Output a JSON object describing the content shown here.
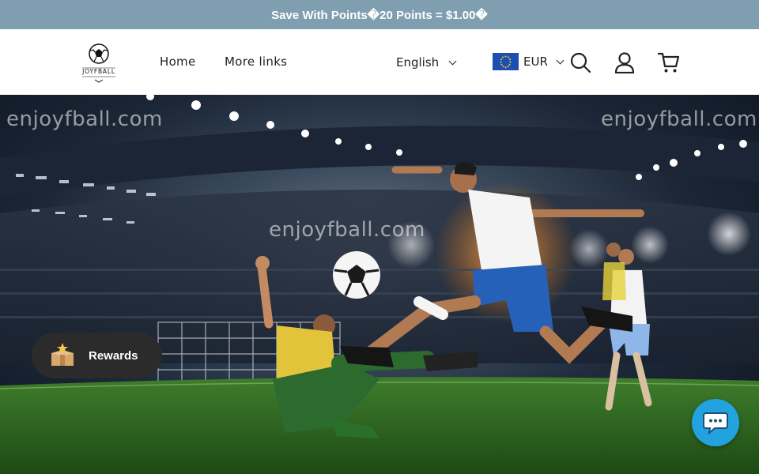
{
  "announcement": {
    "text": "Save With Points�20 Points = $1.00�"
  },
  "header": {
    "logo_text": "JOYFBALL",
    "nav": [
      {
        "label": "Home"
      },
      {
        "label": "More links"
      }
    ],
    "language": {
      "selected": "English"
    },
    "currency": {
      "selected": "EUR",
      "flag": "eu-flag"
    },
    "icons": [
      "search-icon",
      "account-icon",
      "cart-icon"
    ]
  },
  "hero": {
    "watermarks": [
      "enjoyfball.com",
      "enjoyfball.com",
      "enjoyfball.com"
    ],
    "image": "soccer-players-stadium"
  },
  "rewards": {
    "label": "Rewards"
  },
  "chat": {
    "icon": "chat-icon"
  },
  "colors": {
    "announcement_bg": "#7f9eb0",
    "chat_bg": "#23a2e0",
    "rewards_bg": "#2b2b2b"
  }
}
